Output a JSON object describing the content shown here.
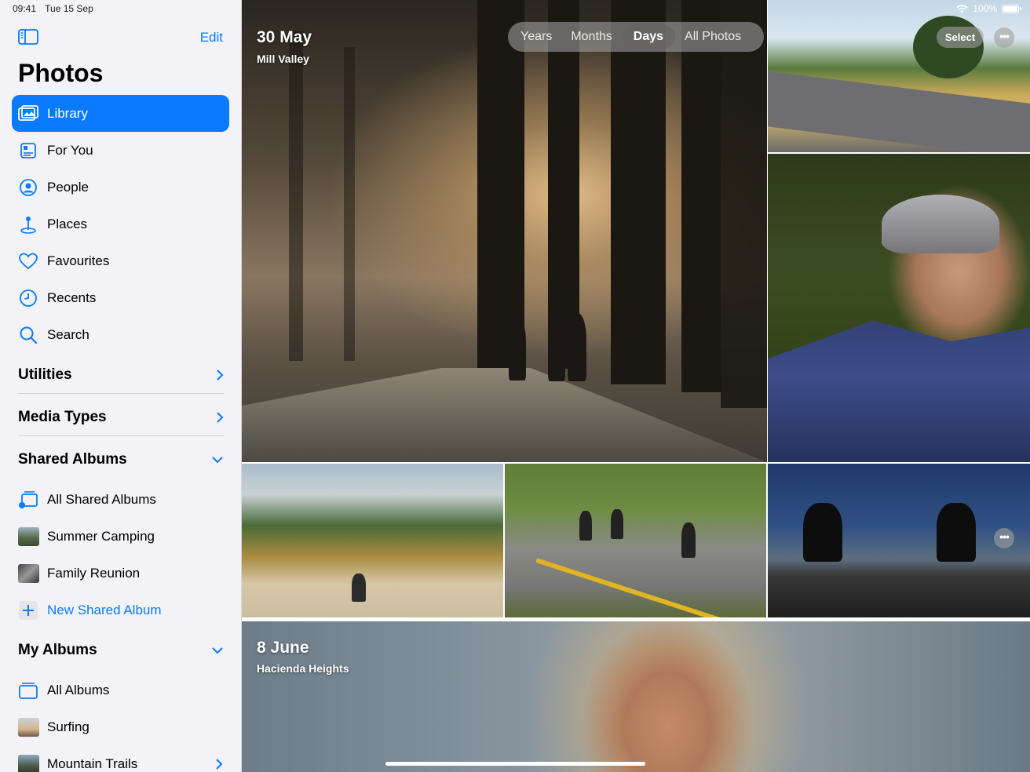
{
  "status_bar": {
    "time": "09:41",
    "date": "Tue 15 Sep",
    "battery": "100%"
  },
  "sidebar": {
    "edit_label": "Edit",
    "title": "Photos",
    "nav": [
      {
        "label": "Library",
        "icon": "library-icon",
        "selected": true
      },
      {
        "label": "For You",
        "icon": "for-you-icon"
      },
      {
        "label": "People",
        "icon": "people-icon"
      },
      {
        "label": "Places",
        "icon": "places-icon"
      },
      {
        "label": "Favourites",
        "icon": "heart-icon"
      },
      {
        "label": "Recents",
        "icon": "clock-icon"
      },
      {
        "label": "Search",
        "icon": "search-icon"
      }
    ],
    "sections": {
      "utilities": "Utilities",
      "media_types": "Media Types",
      "shared_albums": "Shared Albums",
      "my_albums": "My Albums"
    },
    "shared_albums": [
      {
        "label": "All Shared Albums"
      },
      {
        "label": "Summer Camping"
      },
      {
        "label": "Family Reunion"
      },
      {
        "label": "New Shared Album"
      }
    ],
    "my_albums": [
      {
        "label": "All Albums"
      },
      {
        "label": "Surfing"
      },
      {
        "label": "Mountain Trails"
      }
    ]
  },
  "view_switcher": {
    "options": [
      "Years",
      "Months",
      "Days",
      "All Photos"
    ],
    "selected": "Days"
  },
  "toolbar": {
    "select_label": "Select",
    "more_label": "•••"
  },
  "days": [
    {
      "title": "30 May",
      "location": "Mill Valley"
    },
    {
      "title": "8 June",
      "location": "Hacienda Heights"
    }
  ],
  "colors": {
    "accent": "#0a7aff",
    "sidebar_bg": "#f2f2f7"
  }
}
